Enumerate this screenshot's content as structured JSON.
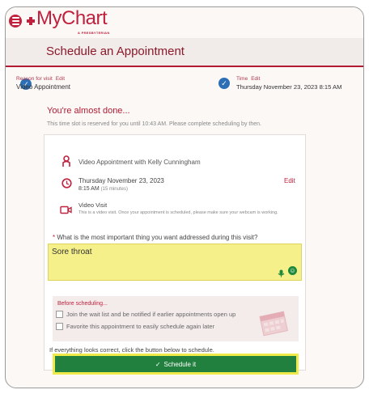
{
  "brand": {
    "logo_text": "MyChart",
    "logo_sub": "& PRESBYTERIAN"
  },
  "page_title": "Schedule an Appointment",
  "progress": {
    "reason": {
      "label": "Reason for visit",
      "edit": "Edit",
      "value": "Video Appointment"
    },
    "time": {
      "label": "Time",
      "edit": "Edit",
      "value": "Thursday November 23, 2023 8:15 AM"
    }
  },
  "almost": "You're almost done...",
  "reserved": "This time slot is reserved for you until 10:43 AM. Please complete scheduling by then.",
  "appointment": {
    "title": "Video Appointment with Kelly Cunningham",
    "date": "Thursday November 23, 2023",
    "time": "8:15 AM",
    "duration": "(15 minutes)",
    "edit": "Edit",
    "visit_title": "Video Visit",
    "visit_desc": "This is a video visit. Once your appointment is scheduled, please make sure your webcam is working."
  },
  "question": {
    "required_mark": "*",
    "text": "What is the most important thing you want addressed during this visit?",
    "answer": "Sore throat"
  },
  "before": {
    "title": "Before scheduling...",
    "options": [
      "Join the wait list and be notified if earlier appointments open up",
      "Favorite this appointment to easily schedule again later"
    ]
  },
  "instructions": "If everything looks correct, click the button below to schedule.",
  "schedule_button": "Schedule it",
  "icons": {
    "menu": "menu-icon",
    "check": "check-icon",
    "person": "person-icon",
    "clock": "clock-icon",
    "video": "video-icon",
    "mic": "mic-icon",
    "emoji": "emoji-icon",
    "calendar": "calendar-illustration"
  },
  "colors": {
    "brand_red": "#c0213d",
    "check_blue": "#2d6fb4",
    "button_green": "#22803f",
    "highlight_yellow": "#f5f08a"
  }
}
